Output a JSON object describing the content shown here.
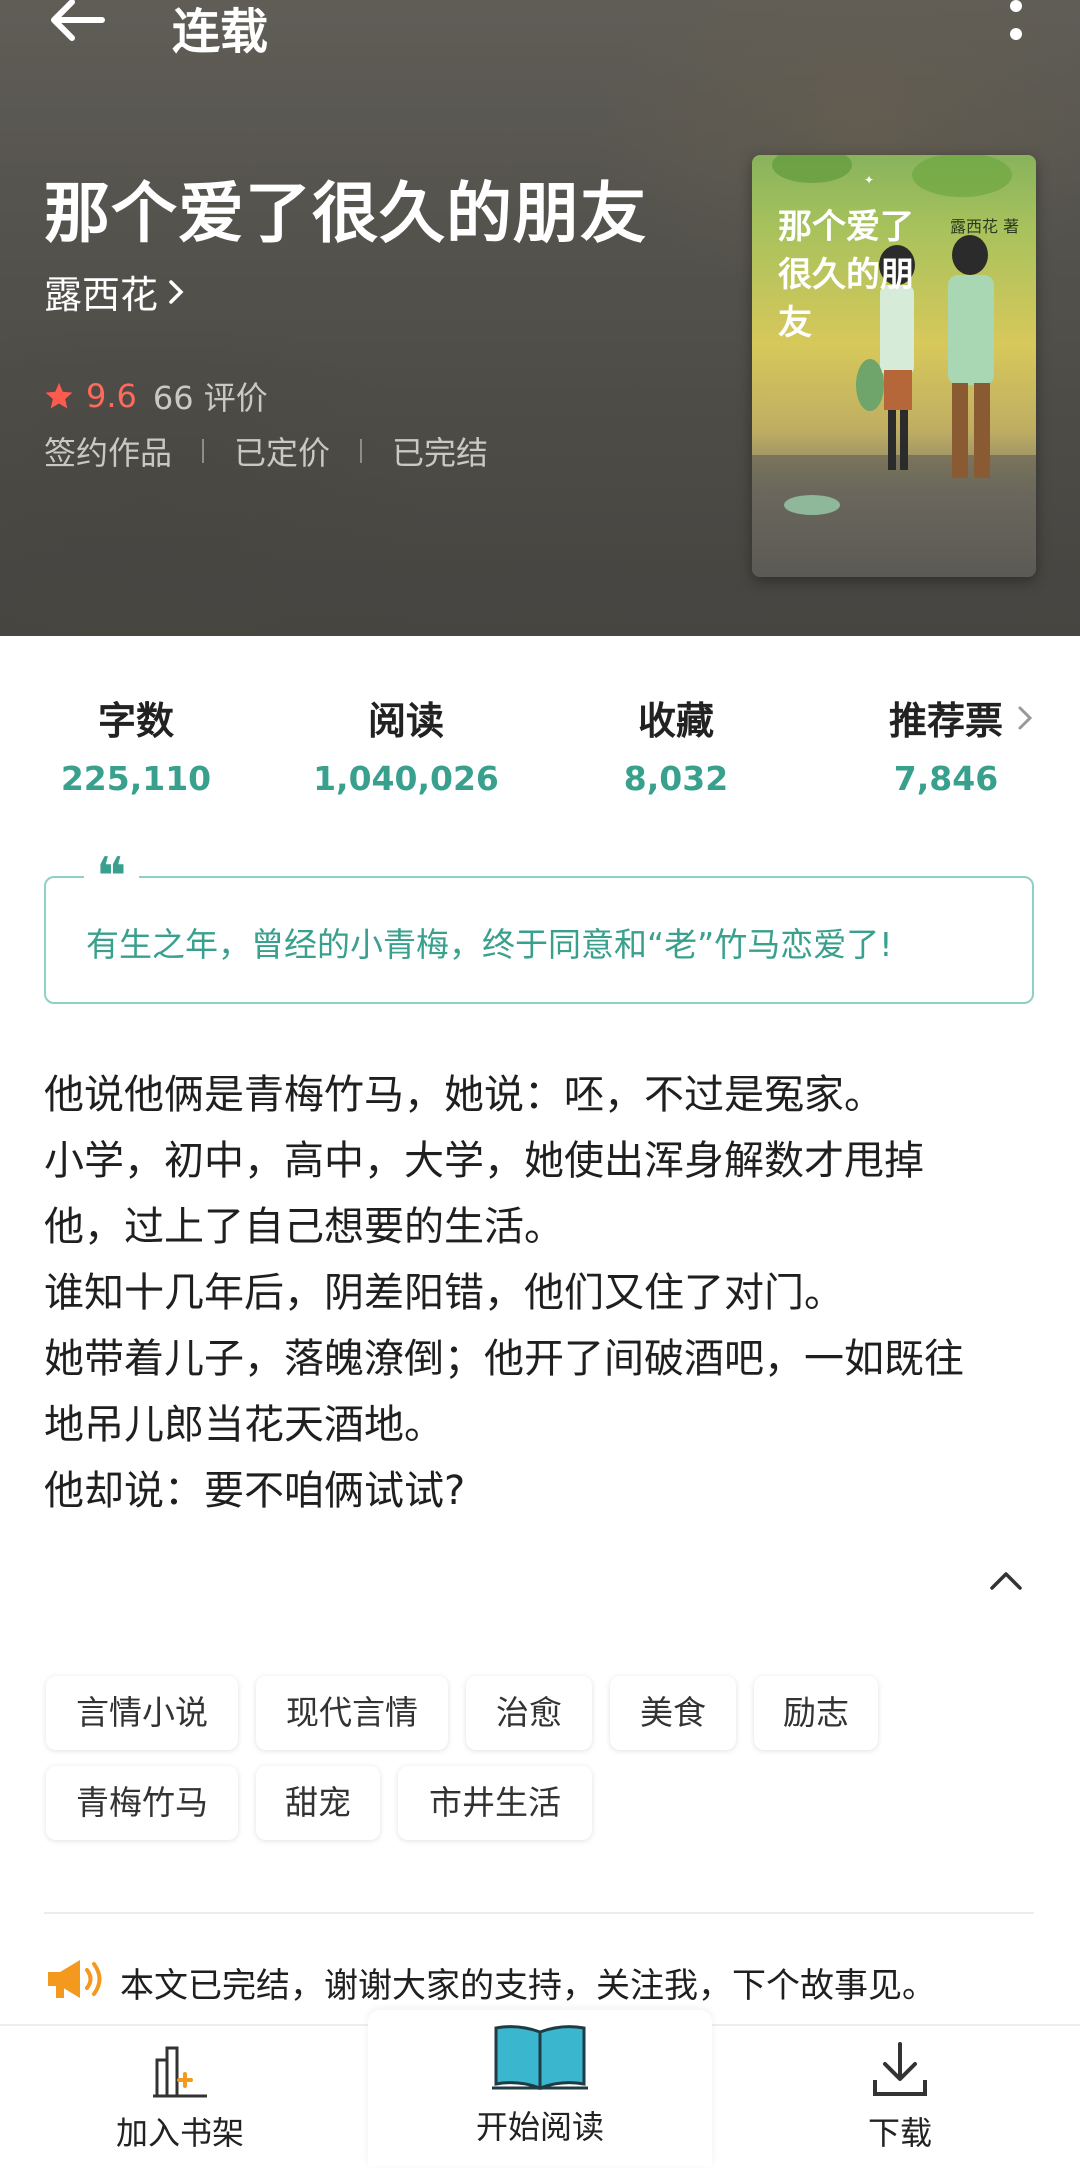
{
  "topbar": {
    "title": "连载"
  },
  "book": {
    "title": "那个爱了很久的朋友",
    "author": "露西花",
    "rating": "9.6",
    "rating_count": "66 评价",
    "meta": [
      "签约作品",
      "已定价",
      "已完结"
    ],
    "cover": {
      "title": "那个爱了很久的朋友",
      "author": "露西花 著"
    }
  },
  "stats": [
    {
      "label": "字数",
      "value": "225,110"
    },
    {
      "label": "阅读",
      "value": "1,040,026"
    },
    {
      "label": "收藏",
      "value": "8,032"
    },
    {
      "label": "推荐票",
      "value": "7,846"
    }
  ],
  "quote": {
    "mark": "❝",
    "text": "有生之年，曾经的小青梅，终于同意和“老”竹马恋爱了!"
  },
  "synopsis": [
    "他说他俩是青梅竹马，她说：呸，不过是冤家。",
    "小学，初中，高中，大学，她使出浑身解数才甩掉",
    "他，过上了自己想要的生活。",
    "谁知十几年后，阴差阳错，他们又住了对门。",
    "她带着儿子，落魄潦倒；他开了间破酒吧，一如既往",
    "地吊儿郎当花天酒地。",
    "他却说：要不咱俩试试?"
  ],
  "tags": [
    "言情小说",
    "现代言情",
    "治愈",
    "美食",
    "励志",
    "青梅竹马",
    "甜宠",
    "市井生活"
  ],
  "notice": "本文已完结，谢谢大家的支持，关注我，下个故事见。",
  "bottom_bar": {
    "add_shelf": "加入书架",
    "start_reading": "开始阅读",
    "download": "下载"
  },
  "colors": {
    "accent": "#3aa08e",
    "rating": "#ff6a5c",
    "notice_icon": "#f39a1e",
    "book_icon": "#3bb6cf"
  }
}
